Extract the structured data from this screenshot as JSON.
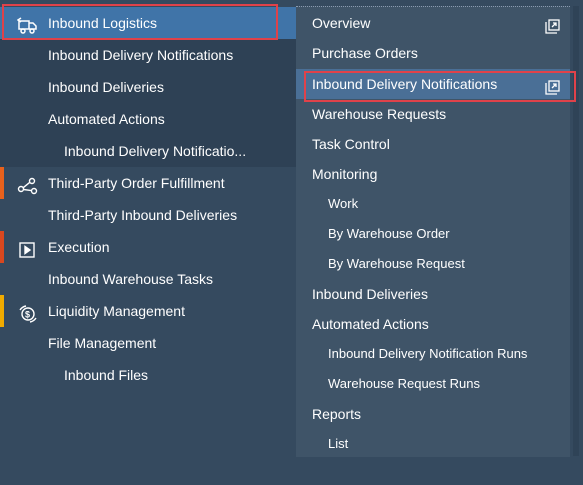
{
  "left_nav": {
    "items": [
      {
        "label": "Inbound Logistics",
        "icon": "truck-icon",
        "selected": true
      },
      {
        "label": "Inbound Delivery Notifications"
      },
      {
        "label": "Inbound Deliveries"
      },
      {
        "label": "Automated Actions"
      },
      {
        "label": "Inbound Delivery Notificatio..."
      },
      {
        "label": "Third-Party Order Fulfillment",
        "icon": "share-icon",
        "accent": "#e8611c"
      },
      {
        "label": "Third-Party Inbound Deliveries"
      },
      {
        "label": "Execution",
        "icon": "play-icon",
        "accent": "#d9481f"
      },
      {
        "label": "Inbound Warehouse Tasks"
      },
      {
        "label": "Liquidity Management",
        "icon": "money-icon",
        "accent": "#f0ab00"
      },
      {
        "label": "File Management"
      },
      {
        "label": "Inbound Files"
      }
    ]
  },
  "menu": {
    "items": [
      {
        "label": "Overview",
        "icon": "open-external-icon"
      },
      {
        "label": "Purchase Orders"
      },
      {
        "label": "Inbound Delivery Notifications",
        "icon": "open-external-icon",
        "active": true
      },
      {
        "label": "Warehouse Requests"
      },
      {
        "label": "Task Control"
      },
      {
        "label": "Monitoring"
      },
      {
        "label": "Work"
      },
      {
        "label": "By Warehouse Order"
      },
      {
        "label": "By Warehouse Request"
      },
      {
        "label": "Inbound Deliveries"
      },
      {
        "label": "Automated Actions"
      },
      {
        "label": "Inbound Delivery Notification Runs"
      },
      {
        "label": "Warehouse Request Runs"
      },
      {
        "label": "Reports"
      },
      {
        "label": "List"
      }
    ]
  },
  "colors": {
    "background": "#354a5f",
    "selected": "#4074a8",
    "highlight_border": "#e0424a"
  }
}
